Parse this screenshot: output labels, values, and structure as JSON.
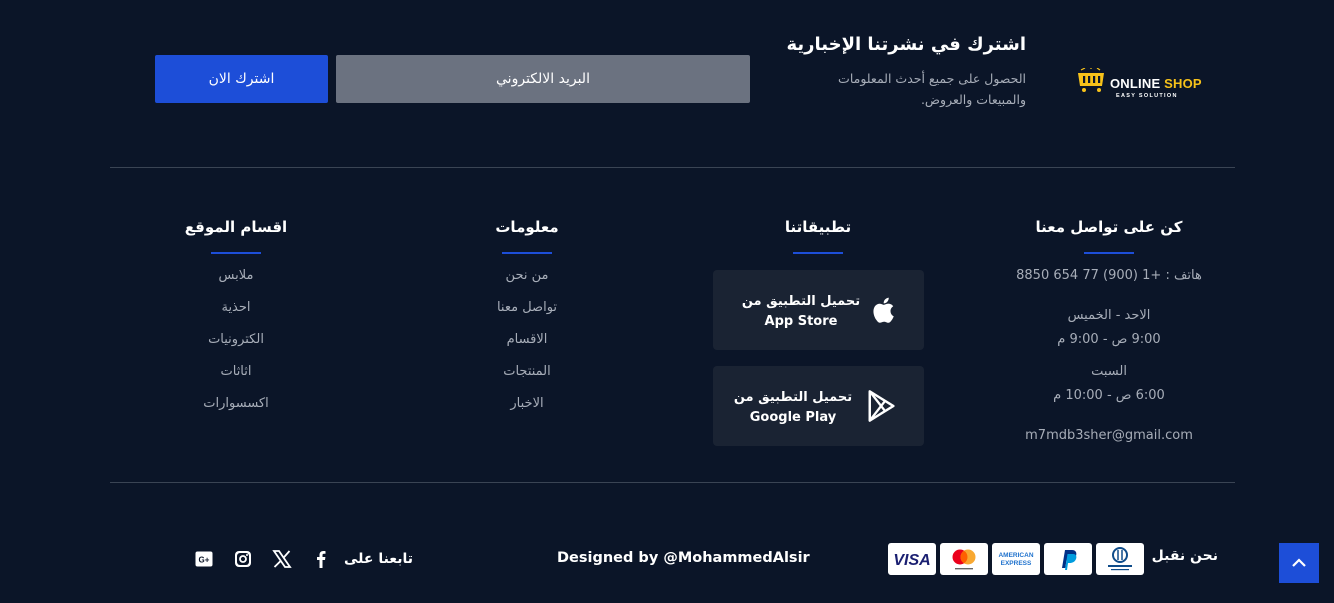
{
  "brand": {
    "name_main": "ONLINE",
    "name_accent": "SHOP",
    "tagline": "EASY SOLUTION"
  },
  "newsletter": {
    "title": "اشترك في نشرتنا الإخبارية",
    "description": "الحصول على جميع أحدث المعلومات والمبيعات والعروض.",
    "email_placeholder": "البريد الالكتروني",
    "subscribe_label": "اشترك الان"
  },
  "contact": {
    "title": "كن على تواصل معنا",
    "phone": "هاتف : +1 (900) 77 654 8850",
    "weekdays": "الاحد - الخميس",
    "weekday_hours": "9:00 ص - 9:00 م",
    "saturday": "السبت",
    "saturday_hours": "6:00 ص - 10:00 م",
    "email": "m7mdb3sher@gmail.com"
  },
  "apps": {
    "title": "تطبيقاتنا",
    "app_store": {
      "line1": "تحميل التطبيق من",
      "line2": "App Store",
      "icon": "apple-icon"
    },
    "google_play": {
      "line1": "تحميل التطبيق من",
      "line2": "Google Play",
      "icon": "google-play-icon"
    }
  },
  "info": {
    "title": "معلومات",
    "links": [
      "من نحن",
      "تواصل معنا",
      "الاقسام",
      "المنتجات",
      "الاخبار"
    ]
  },
  "sections": {
    "title": "اقسام الموقع",
    "links": [
      "ملابس",
      "احذية",
      "الكترونيات",
      "اثاثات",
      "اكسسوارات"
    ]
  },
  "bottom": {
    "accept_label": "نحن نقبل",
    "cards": [
      "visa",
      "mastercard",
      "american-express",
      "paypal",
      "diners-club"
    ],
    "designed_by": "Designed by @MohammedAlsir",
    "follow_label": "تابعنا على",
    "socials": [
      "facebook-icon",
      "x-icon",
      "instagram-icon",
      "google-plus-icon"
    ]
  },
  "colors": {
    "background": "#0b1528",
    "accent": "#1d4ed8",
    "brand_yellow": "#f7c21a",
    "muted_text": "#a7adb8"
  }
}
